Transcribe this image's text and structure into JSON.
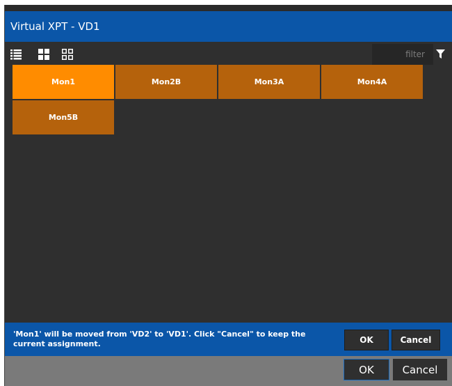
{
  "window": {
    "title": "Virtual XPT - VD1"
  },
  "toolbar": {
    "view_icons": [
      "list-view-icon",
      "large-tiles-icon",
      "small-tiles-icon"
    ],
    "filter": {
      "placeholder": "filter",
      "value": ""
    },
    "filter_icon": "filter-funnel-icon"
  },
  "monitors": [
    {
      "label": "Mon1",
      "selected": true
    },
    {
      "label": "Mon2B",
      "selected": false
    },
    {
      "label": "Mon3A",
      "selected": false
    },
    {
      "label": "Mon4A",
      "selected": false
    },
    {
      "label": "Mon5B",
      "selected": false
    }
  ],
  "message": {
    "text": "'Mon1' will be moved from 'VD2' to 'VD1'. Click \"Cancel\" to keep the current assignment.",
    "ok_label": "OK",
    "cancel_label": "Cancel"
  },
  "footer": {
    "ok_label": "OK",
    "cancel_label": "Cancel"
  },
  "colors": {
    "title_bar": "#0b56a8",
    "tile_selected": "#ff8c00",
    "tile_normal": "#b5620c",
    "background": "#2f2f2f",
    "footer": "#7a7a7a"
  }
}
